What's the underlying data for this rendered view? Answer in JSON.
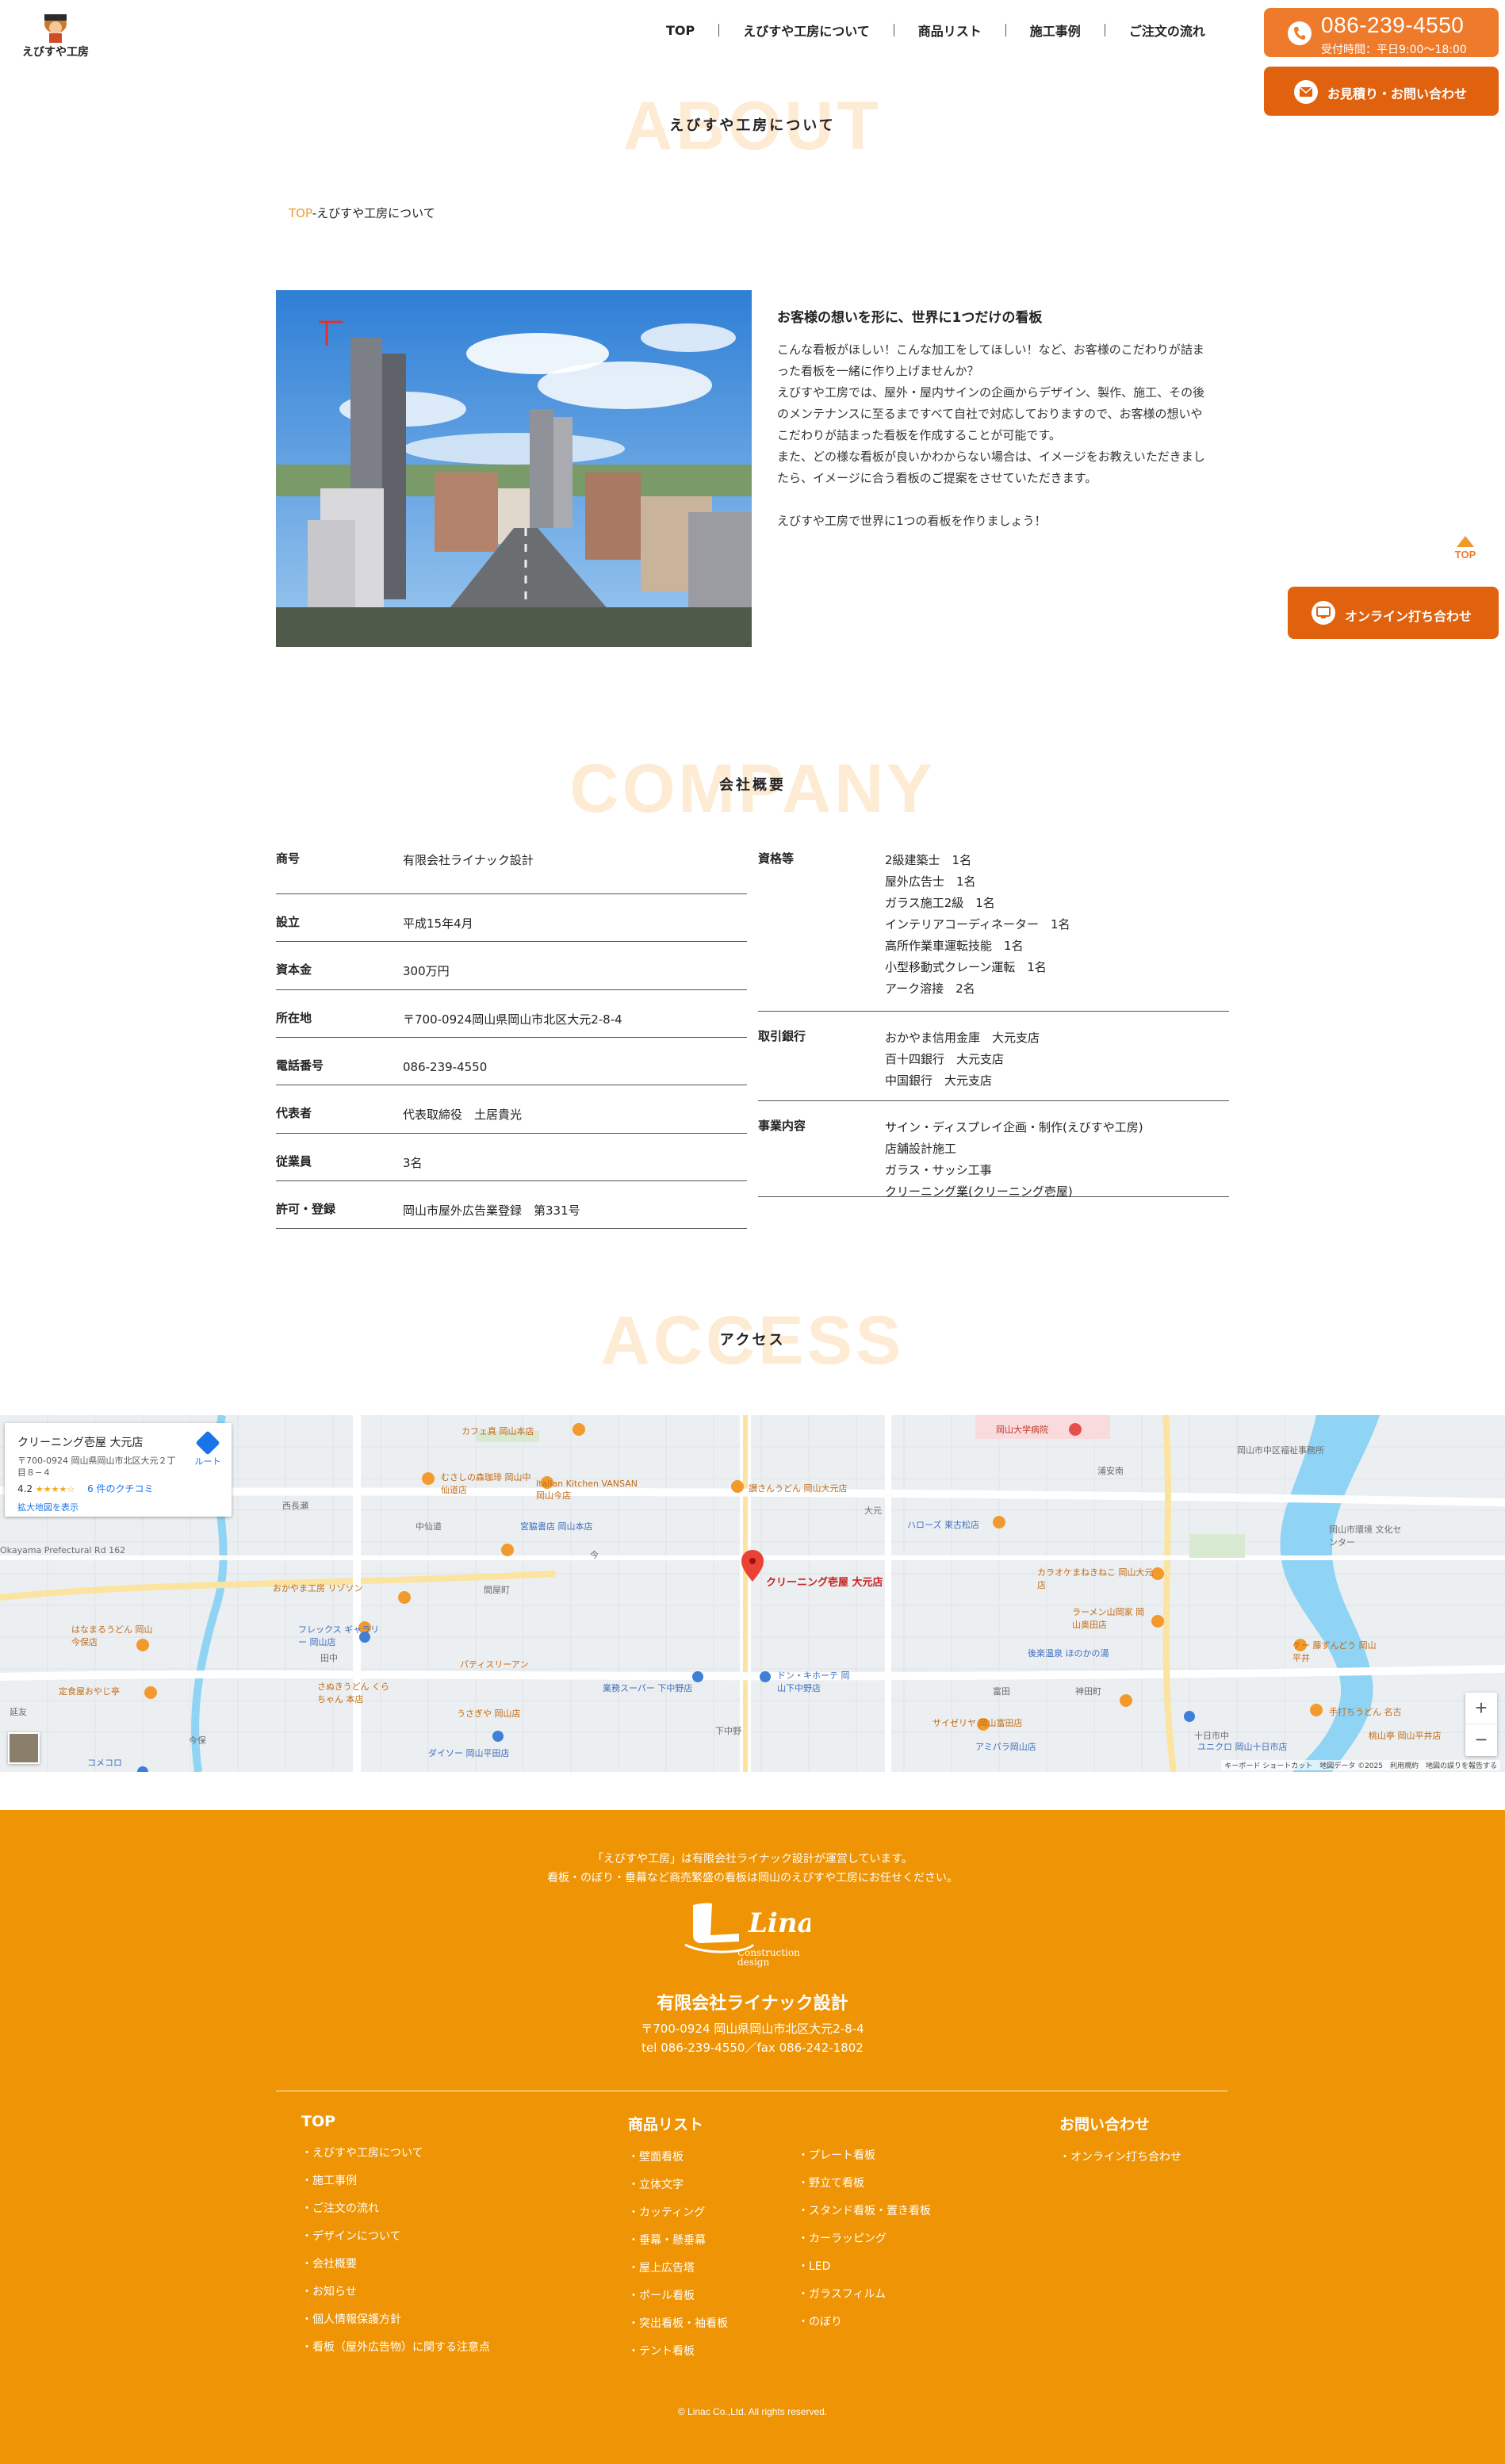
{
  "header": {
    "logo_alt": "えびすや工房",
    "nav": [
      "TOP",
      "えびすや工房について",
      "商品リスト",
      "施工事例",
      "ご注文の流れ"
    ],
    "tel": "086-239-4550",
    "tel_hours": "受付時間：平日9:00〜18:00",
    "quote_label": "お見積り・お問い合わせ",
    "page_top_label": "TOP",
    "online_label": "オンライン打ち合わせ"
  },
  "about": {
    "bg_word": "ABOUT",
    "title": "えびすや工房について",
    "breadcrumb_link": "TOP",
    "breadcrumb_sep": "-",
    "breadcrumb_current": "えびすや工房について",
    "heading": "お客様の想いを形に、世界に1つだけの看板",
    "paragraphs": [
      "こんな看板がほしい！こんな加工をしてほしい！など、お客様のこだわりが詰まった看板を一緒に作り上げませんか？",
      "えびすや工房では、屋外・屋内サインの企画からデザイン、製作、施工、その後のメンテナンスに至るまですべて自社で対応しておりますので、お客様の想いやこだわりが詰まった看板を作成することが可能です。",
      "また、どの様な看板が良いかわからない場合は、イメージをお教えいただきましたら、イメージに合う看板のご提案をさせていただきます。",
      "えびすや工房で世界に1つの看板を作りましょう！"
    ]
  },
  "company": {
    "bg_word": "COMPANY",
    "title": "会社概要",
    "left": [
      {
        "k": "商号",
        "v": "有限会社ライナック設計"
      },
      {
        "k": "設立",
        "v": "平成15年4月"
      },
      {
        "k": "資本金",
        "v": "300万円"
      },
      {
        "k": "所在地",
        "v": "〒700-0924岡山県岡山市北区大元2-8-4"
      },
      {
        "k": "電話番号",
        "v": "086-239-4550"
      },
      {
        "k": "代表者",
        "v": "代表取締役　土居貴光"
      },
      {
        "k": "従業員",
        "v": "3名"
      },
      {
        "k": "許可・登録",
        "v": "岡山市屋外広告業登録　第331号"
      }
    ],
    "right": [
      {
        "k": "資格等",
        "v": [
          "2級建築士　1名",
          "屋外広告士　1名",
          "ガラス施工2級　1名",
          "インテリアコーディネーター　1名",
          "高所作業車運転技能　1名",
          "小型移動式クレーン運転　1名",
          "アーク溶接　2名"
        ]
      },
      {
        "k": "取引銀行",
        "v": [
          "おかやま信用金庫　大元支店",
          "百十四銀行　大元支店",
          "中国銀行　大元支店"
        ]
      },
      {
        "k": "事業内容",
        "v": [
          "サイン・ディスプレイ企画・制作(えびすや工房)",
          "店舗設計施工",
          "ガラス・サッシ工事",
          "クリーニング業(クリーニング壱屋)"
        ]
      }
    ]
  },
  "access": {
    "bg_word": "ACCESS",
    "title": "アクセス",
    "map": {
      "place_name": "クリーニング壱屋 大元店",
      "place_addr": "〒700-0924 岡山県岡山市北区大元２丁目８−４",
      "rating": "4.2",
      "stars": "★★★★☆",
      "reviews": "6 件のクチコミ",
      "enlarge": "拡大地図を表示",
      "route": "ルート",
      "pin_label": "クリーニング壱屋 大元店",
      "attribution": "キーボード ショートカット　地図データ ©2025　利用規約　地図の誤りを報告する",
      "labels": [
        "カフェ真 岡山本店",
        "むさしの森珈琲 岡山中仙道店",
        "Italian Kitchen VANSAN 岡山今店",
        "宮脇書店 岡山本店",
        "讃さんうどん 岡山大元店",
        "ハローズ 東古松店",
        "岡山大学病院",
        "カラオケまねきねこ 岡山大元店",
        "ラーメン山岡家 岡山奥田店",
        "後楽温泉 ほのかの湯",
        "ドン・キホーテ 岡山下中野店",
        "業務スーパー 下中野店",
        "サイゼリヤ 岡山富田店",
        "アミパラ岡山店",
        "ユニクロ 岡山十日市店",
        "ダイソー 岡山平田店",
        "うさぎや 岡山店",
        "さぬきうどん くらちゃん 本店",
        "おかやま工房 リゾソン",
        "はなまるうどん 岡山今保店",
        "定食屋おやじ亭",
        "コメコロ",
        "パティスリーアン",
        "フレックス ギャラリー 岡山店",
        "間屋町",
        "中仙道",
        "西長瀬",
        "今",
        "田中",
        "今保",
        "延友",
        "大元",
        "富田",
        "神田町",
        "下中野",
        "十日市中",
        "浦安南",
        "岡山市中区福祉事務所",
        "岡山市環境 文化センター",
        "ケー 藤ずんどう 岡山平井",
        "手打ちうどん 名古",
        "桃山亭 岡山平井店",
        "Okayama Prefectural Rd 162"
      ]
    }
  },
  "footer": {
    "lead_1": "「えびすや工房」は有限会社ライナック設計が運営しています。",
    "lead_2": "看板・のぼり・垂幕など商売繁盛の看板は岡山のえびすや工房にお任せください。",
    "logo_word": "Linac",
    "logo_sub_1": "Construction",
    "logo_sub_2": "design",
    "company": "有限会社ライナック設計",
    "addr": "〒700-0924 岡山県岡山市北区大元2-8-4",
    "telfax": "tel 086-239-4550／fax 086-242-1802",
    "col1_title": "TOP",
    "col1": [
      "えびすや工房について",
      "施工事例",
      "ご注文の流れ",
      "デザインについて",
      "会社概要",
      "お知らせ",
      "個人情報保護方針",
      "看板（屋外広告物）に関する注意点"
    ],
    "col2_title": "商品リスト",
    "col2a": [
      "壁面看板",
      "立体文字",
      "カッティング",
      "垂幕・懸垂幕",
      "屋上広告塔",
      "ポール看板",
      "突出看板・袖看板",
      "テント看板"
    ],
    "col2b": [
      "プレート看板",
      "野立て看板",
      "スタンド看板・置き看板",
      "カーラッピング",
      "LED",
      "ガラスフィルム",
      "のぼり"
    ],
    "col3_title": "お問い合わせ",
    "col3": [
      "オンライン打ち合わせ"
    ],
    "copyright": "© Linac Co.,Ltd. All rights reserved."
  },
  "colors": {
    "accent": "#ee7b2c",
    "accent_dark": "#e0620f",
    "footer": "#ef9405",
    "bg_word": "#fdebd3"
  }
}
